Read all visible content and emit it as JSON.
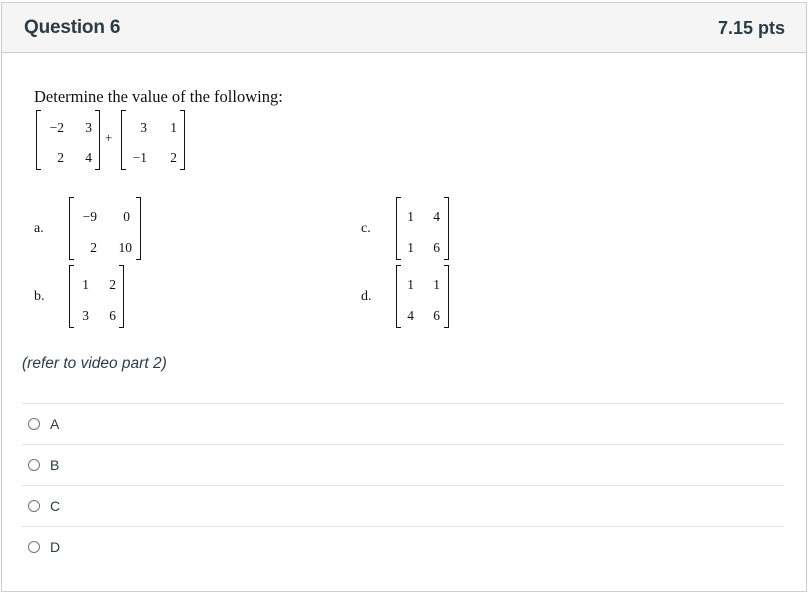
{
  "question": {
    "title": "Question 6",
    "points": "7.15 pts"
  },
  "problem": {
    "prompt": "Determine the value of the following:",
    "matrix_a": [
      [
        "−2",
        "3"
      ],
      [
        "2",
        "4"
      ]
    ],
    "operator": "+",
    "matrix_b": [
      [
        "3",
        "1"
      ],
      [
        "−1",
        "2"
      ]
    ]
  },
  "options": [
    {
      "label": "a.",
      "matrix": [
        [
          "−9",
          "0"
        ],
        [
          "2",
          "10"
        ]
      ]
    },
    {
      "label": "b.",
      "matrix": [
        [
          "1",
          "2"
        ],
        [
          "3",
          "6"
        ]
      ]
    },
    {
      "label": "c.",
      "matrix": [
        [
          "1",
          "4"
        ],
        [
          "1",
          "6"
        ]
      ]
    },
    {
      "label": "d.",
      "matrix": [
        [
          "1",
          "1"
        ],
        [
          "4",
          "6"
        ]
      ]
    }
  ],
  "note": "(refer to video part 2)",
  "answers": [
    {
      "label": "A"
    },
    {
      "label": "B"
    },
    {
      "label": "C"
    },
    {
      "label": "D"
    }
  ]
}
